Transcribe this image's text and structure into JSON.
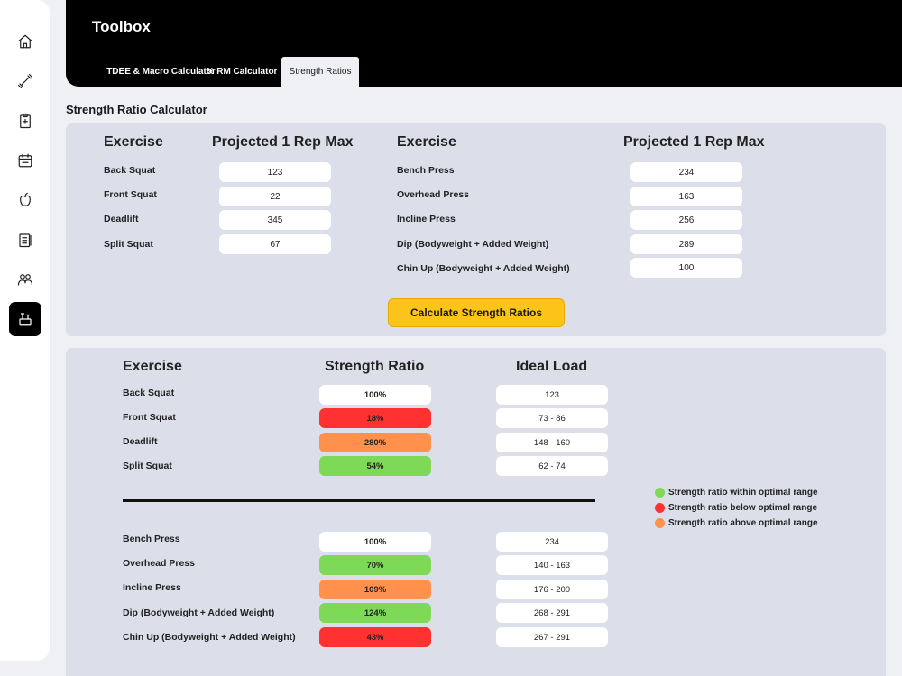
{
  "app": {
    "title": "Toolbox"
  },
  "tabs": [
    {
      "label": "TDEE & Macro Calculator"
    },
    {
      "label": "% RM Calculator"
    },
    {
      "label": "Strength Ratios"
    }
  ],
  "sidebar": {
    "items": [
      {
        "icon": "home-icon"
      },
      {
        "icon": "dumbbell-icon"
      },
      {
        "icon": "clipboard-icon"
      },
      {
        "icon": "calendar-icon"
      },
      {
        "icon": "apple-icon"
      },
      {
        "icon": "checklist-icon"
      },
      {
        "icon": "users-icon"
      },
      {
        "icon": "toolbox-icon"
      }
    ]
  },
  "calculator": {
    "title": "Strength Ratio Calculator",
    "col_exercise": "Exercise",
    "col_1rm": "Projected 1 Rep Max",
    "lower": [
      {
        "name": "Back Squat",
        "value": "123"
      },
      {
        "name": "Front Squat",
        "value": "22"
      },
      {
        "name": "Deadlift",
        "value": "345"
      },
      {
        "name": "Split Squat",
        "value": "67"
      }
    ],
    "upper": [
      {
        "name": "Bench Press",
        "value": "234"
      },
      {
        "name": "Overhead Press",
        "value": "163"
      },
      {
        "name": "Incline Press",
        "value": "256"
      },
      {
        "name": "Dip (Bodyweight + Added Weight)",
        "value": "289"
      },
      {
        "name": "Chin Up (Bodyweight + Added Weight)",
        "value": "100"
      }
    ],
    "button_label": "Calculate Strength Ratios"
  },
  "results": {
    "col_exercise": "Exercise",
    "col_ratio": "Strength Ratio",
    "col_load": "Ideal Load",
    "lower": [
      {
        "name": "Back Squat",
        "ratio": "100%",
        "status": "neutral",
        "load": "123"
      },
      {
        "name": "Front Squat",
        "ratio": "18%",
        "status": "below",
        "load": "73 - 86"
      },
      {
        "name": "Deadlift",
        "ratio": "280%",
        "status": "above",
        "load": "148 - 160"
      },
      {
        "name": "Split Squat",
        "ratio": "54%",
        "status": "within",
        "load": "62 - 74"
      }
    ],
    "upper": [
      {
        "name": "Bench Press",
        "ratio": "100%",
        "status": "neutral",
        "load": "234"
      },
      {
        "name": "Overhead Press",
        "ratio": "70%",
        "status": "within",
        "load": "140 - 163"
      },
      {
        "name": "Incline Press",
        "ratio": "109%",
        "status": "above",
        "load": "176 - 200"
      },
      {
        "name": "Dip (Bodyweight + Added Weight)",
        "ratio": "124%",
        "status": "within",
        "load": "268 - 291"
      },
      {
        "name": "Chin Up (Bodyweight + Added Weight)",
        "ratio": "43%",
        "status": "below",
        "load": "267 - 291"
      }
    ],
    "legend": [
      {
        "label": "Strength ratio within optimal range",
        "color": "#7ed957"
      },
      {
        "label": "Strength ratio below optimal range",
        "color": "#ff3131"
      },
      {
        "label": "Strength ratio above optimal range",
        "color": "#ff914d"
      }
    ]
  },
  "colors": {
    "neutral": "#ffffff",
    "within": "#7ed957",
    "below": "#ff3131",
    "above": "#ff914d",
    "accent": "#fcc419"
  }
}
